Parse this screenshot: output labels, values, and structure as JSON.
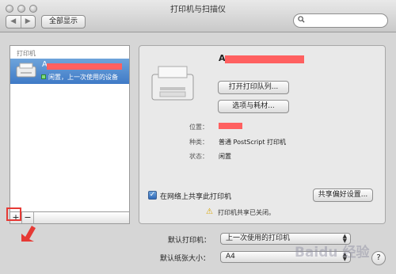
{
  "window": {
    "title": "打印机与扫描仪",
    "nav_back": "◀",
    "nav_forward": "▶",
    "show_all": "全部显示",
    "search_placeholder": ""
  },
  "sidebar": {
    "header": "打印机",
    "printers": [
      {
        "name": "A",
        "status": "闲置，上一次使用的设备"
      }
    ],
    "add_label": "+",
    "remove_label": "−"
  },
  "detail": {
    "printer_name": "A",
    "open_queue_label": "打开打印队列...",
    "options_label": "选项与耗材...",
    "location_label": "位置：",
    "kind_label": "种类：",
    "kind_value": "普通 PostScript 打印机",
    "status_label": "状态：",
    "status_value": "闲置",
    "share_label": "在网络上共享此打印机",
    "share_checked": true,
    "share_prefs_label": "共享偏好设置...",
    "warning_text": "打印机共享已关闭。"
  },
  "footer": {
    "default_printer_label": "默认打印机：",
    "default_printer_value": "上一次使用的打印机",
    "default_paper_label": "默认纸张大小：",
    "default_paper_value": "A4",
    "help": "?"
  },
  "watermark": "Baidu 经验",
  "colors": {
    "highlight": "#3f7ac6",
    "annotation_red": "#e63a35",
    "redaction": "#ff6060"
  }
}
